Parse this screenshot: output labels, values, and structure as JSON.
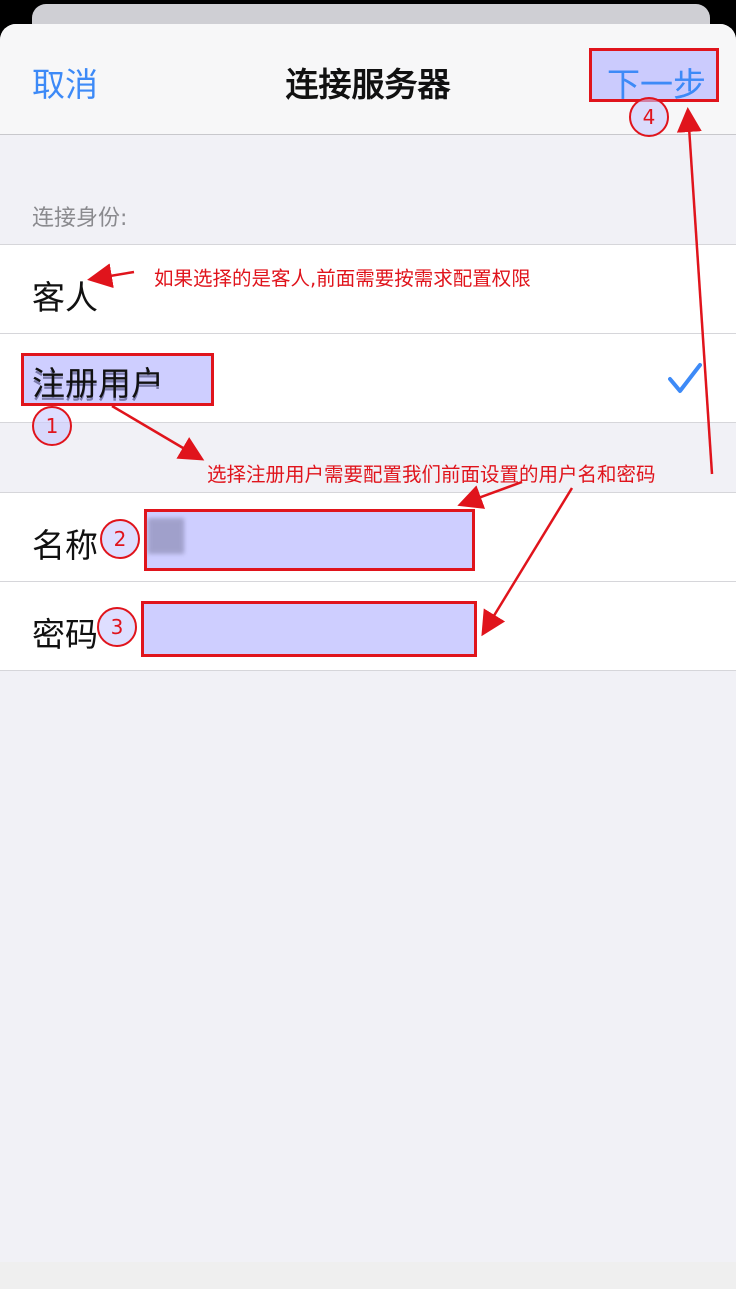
{
  "nav": {
    "cancel_label": "取消",
    "title": "连接服务器",
    "next_label": "下一步"
  },
  "section": {
    "label": "连接身份:"
  },
  "identity_options": [
    {
      "label": "客人",
      "selected": false
    },
    {
      "label": "注册用户",
      "selected": true
    }
  ],
  "fields": [
    {
      "label": "名称",
      "value": ""
    },
    {
      "label": "密码",
      "value": ""
    }
  ],
  "annotations": {
    "guest_note": "如果选择的是客人,前面需要按需求配置权限",
    "registered_note": "选择注册用户需要配置我们前面设置的用户名和密码",
    "step_numbers": [
      "1",
      "2",
      "3",
      "4"
    ]
  },
  "colors": {
    "accent_blue": "#3d8af7",
    "annotation_red": "#e0141c",
    "highlight_fill": "#b4b4ff"
  },
  "icons": {
    "selected_mark": "checkmark-icon"
  }
}
